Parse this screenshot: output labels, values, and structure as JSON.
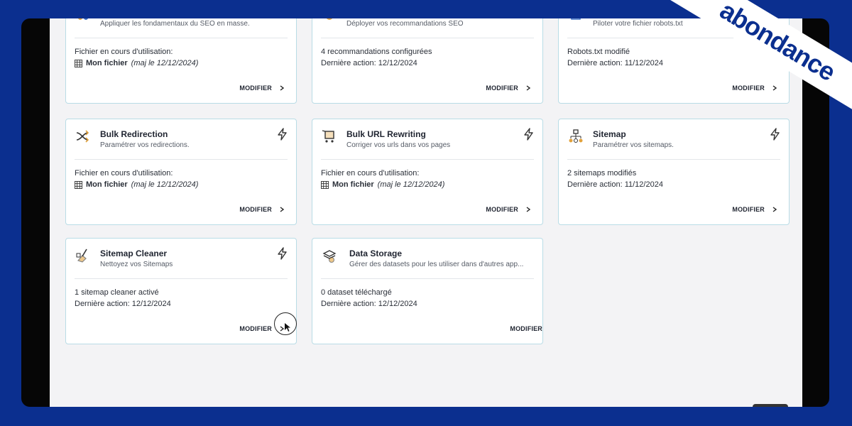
{
  "brand": {
    "logo_text": "abondance",
    "color": "#0b2f8f"
  },
  "cards": [
    {
      "id": "top-1",
      "title": "",
      "subtitle": "Appliquer les fondamentaux du SEO en masse.",
      "line1": "Fichier en cours d'utilisation:",
      "file_label": "Mon fichier",
      "file_meta": "(maj le 12/12/2024)",
      "action": "MODIFIER"
    },
    {
      "id": "top-2",
      "title": "",
      "subtitle": "Déployer vos recommandations SEO",
      "line1": "4 recommandations configurées",
      "line2": "Dernière action: 12/12/2024",
      "action": "MODIFIER"
    },
    {
      "id": "top-3",
      "title": "",
      "subtitle": "Piloter votre fichier robots.txt",
      "line1": "Robots.txt modifié",
      "line2": "Dernière action: 11/12/2024",
      "action": "MODIFIER"
    },
    {
      "id": "bulk-redirection",
      "title": "Bulk Redirection",
      "subtitle": "Paramétrer vos redirections.",
      "line1": "Fichier en cours d'utilisation:",
      "file_label": "Mon fichier",
      "file_meta": "(maj le 12/12/2024)",
      "action": "MODIFIER"
    },
    {
      "id": "bulk-url-rewriting",
      "title": "Bulk URL Rewriting",
      "subtitle": "Corriger vos urls dans vos pages",
      "line1": "Fichier en cours d'utilisation:",
      "file_label": "Mon fichier",
      "file_meta": "(maj le 12/12/2024)",
      "action": "MODIFIER"
    },
    {
      "id": "sitemap",
      "title": "Sitemap",
      "subtitle": "Paramétrer vos sitemaps.",
      "line1": "2 sitemaps modifiés",
      "line2": "Dernière action: 11/12/2024",
      "action": "MODIFIER"
    },
    {
      "id": "sitemap-cleaner",
      "title": "Sitemap Cleaner",
      "subtitle": "Nettoyez vos Sitemaps",
      "line1": "1 sitemap cleaner activé",
      "line2": "Dernière action: 12/12/2024",
      "action": "MODIFIER"
    },
    {
      "id": "data-storage",
      "title": "Data Storage",
      "subtitle": "Gérer des datasets pour les utiliser dans d'autres app...",
      "line1": "0 dataset téléchargé",
      "line2": "Dernière action: 12/12/2024",
      "action": "MODIFIER"
    }
  ],
  "icons": {
    "bolt": "lightning-icon",
    "chevron": "chevron-right-icon",
    "file": "table-grid-icon"
  }
}
